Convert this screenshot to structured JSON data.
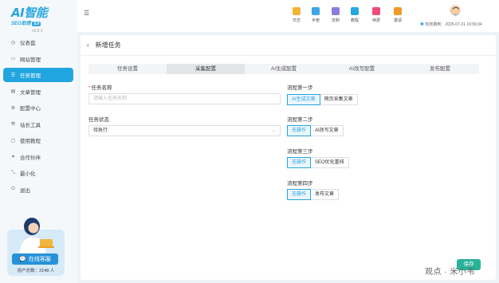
{
  "app": {
    "logo_main": "AI智能",
    "logo_sub": "SEO助理",
    "logo_badge": "5.0",
    "version": "v3.0.1"
  },
  "sidebar": {
    "items": [
      {
        "label": "仪表盘",
        "icon": "dashboard-icon",
        "glyph": "◷"
      },
      {
        "label": "网站管理",
        "icon": "website-icon",
        "glyph": "▭"
      },
      {
        "label": "任务管理",
        "icon": "task-icon",
        "glyph": "☰",
        "active": true
      },
      {
        "label": "文章管理",
        "icon": "article-icon",
        "glyph": "▤"
      },
      {
        "label": "配置中心",
        "icon": "settings-icon",
        "glyph": "⚙"
      },
      {
        "label": "站长工具",
        "icon": "tools-icon",
        "glyph": "⚒"
      },
      {
        "label": "使用教程",
        "icon": "tutorial-icon",
        "glyph": "▢"
      },
      {
        "label": "合作伙伴",
        "icon": "partner-icon",
        "glyph": "⚭"
      },
      {
        "label": "最小化",
        "icon": "minimize-icon",
        "glyph": "⤡"
      },
      {
        "label": "退出",
        "icon": "logout-icon",
        "glyph": "⏻"
      }
    ],
    "support_button": "在线客服",
    "user_count": "用户总数：2248 人"
  },
  "header": {
    "tools": [
      {
        "label": "日志",
        "icon": "log-icon",
        "color": "#f5b335"
      },
      {
        "label": "手册",
        "icon": "manual-icon",
        "color": "#3da5e8"
      },
      {
        "label": "定制",
        "icon": "custom-icon",
        "color": "#8c7be0"
      },
      {
        "label": "教程",
        "icon": "tutorial-video-icon",
        "color": "#28a7e2"
      },
      {
        "label": "续费",
        "icon": "renew-icon",
        "color": "#ef4a7c"
      },
      {
        "label": "邀请",
        "icon": "invite-icon",
        "color": "#f29a2e"
      }
    ],
    "expire_text": "有效期到：2025-07-31 16:56:04"
  },
  "page": {
    "title": "新增任务",
    "tabs": [
      {
        "label": "任务设置"
      },
      {
        "label": "采集配置",
        "active": true
      },
      {
        "label": "AI生成配置"
      },
      {
        "label": "AI改写配置"
      },
      {
        "label": "发布配置"
      }
    ],
    "task_name": {
      "label": "任务名称",
      "placeholder": "请输入任务名称"
    },
    "task_status": {
      "label": "任务状态",
      "value": "待执行"
    },
    "steps": [
      {
        "label": "流程第一步",
        "options": [
          {
            "label": "AI生成文章",
            "selected": true
          },
          {
            "label": "网页采集文章"
          }
        ]
      },
      {
        "label": "流程第二步",
        "options": [
          {
            "label": "无操作",
            "selected": true
          },
          {
            "label": "AI改写文章"
          }
        ]
      },
      {
        "label": "流程第三步",
        "options": [
          {
            "label": "无操作",
            "selected": true
          },
          {
            "label": "SEO优化重排"
          }
        ]
      },
      {
        "label": "流程第四步",
        "options": [
          {
            "label": "无操作",
            "selected": true
          },
          {
            "label": "发布文章"
          }
        ]
      }
    ],
    "save_button": "保存",
    "watermark": "观点 · 米小韦"
  }
}
